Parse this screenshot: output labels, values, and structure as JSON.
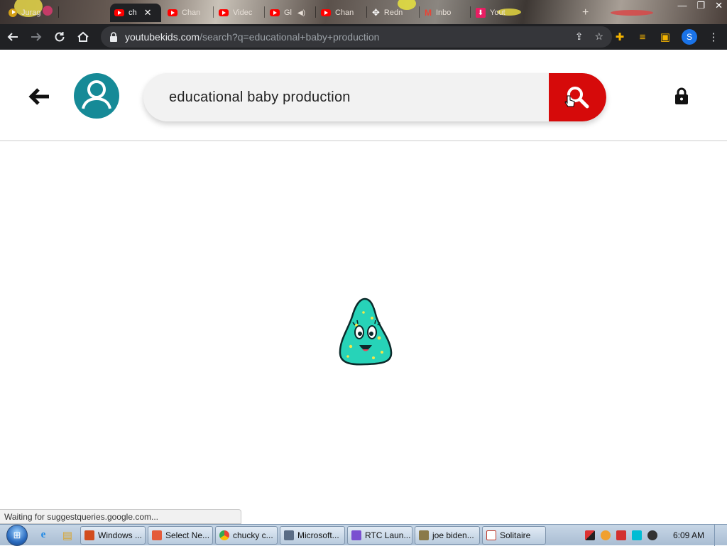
{
  "browser": {
    "tabs": [
      {
        "label": "Jurag",
        "icon": "chrome-profile-icon",
        "active": false
      },
      {
        "label": "ch",
        "icon": "youtube-icon",
        "active": true
      },
      {
        "label": "Chan",
        "icon": "youtube-icon",
        "active": false
      },
      {
        "label": "Videc",
        "icon": "youtube-icon",
        "active": false
      },
      {
        "label": "Gl",
        "icon": "youtube-icon",
        "active": false
      },
      {
        "label": "Chan",
        "icon": "youtube-icon",
        "active": false
      },
      {
        "label": "Redn",
        "icon": "move-icon",
        "active": false
      },
      {
        "label": "Inbo",
        "icon": "gmail-icon",
        "active": false
      },
      {
        "label": "Yout",
        "icon": "download-icon",
        "active": false
      }
    ],
    "close_tab": "✕",
    "url_host": "youtubekids.com",
    "url_path": "/search?q=educational+baby+production",
    "profile_initial": "S",
    "status_text": "Waiting for suggestqueries.google.com..."
  },
  "ytkids": {
    "search_query": "educational baby production",
    "colors": {
      "accent": "#d60a0a",
      "avatar": "#168a97",
      "mascot": "#27d3b8"
    }
  },
  "taskbar": {
    "tasks": [
      {
        "label": "Windows ...",
        "icon_color": "#d24d1e"
      },
      {
        "label": "Select Ne...",
        "icon_color": "#e45b3a"
      },
      {
        "label": "chucky c...",
        "icon_color": "#34a853"
      },
      {
        "label": "Microsoft...",
        "icon_color": "#5a6c85"
      },
      {
        "label": "RTC Laun...",
        "icon_color": "#7a4fd0"
      },
      {
        "label": "joe biden...",
        "icon_color": "#8a7a4a"
      },
      {
        "label": "Solitaire",
        "icon_color": "#c0392b"
      }
    ],
    "clock": "6:09 AM"
  }
}
